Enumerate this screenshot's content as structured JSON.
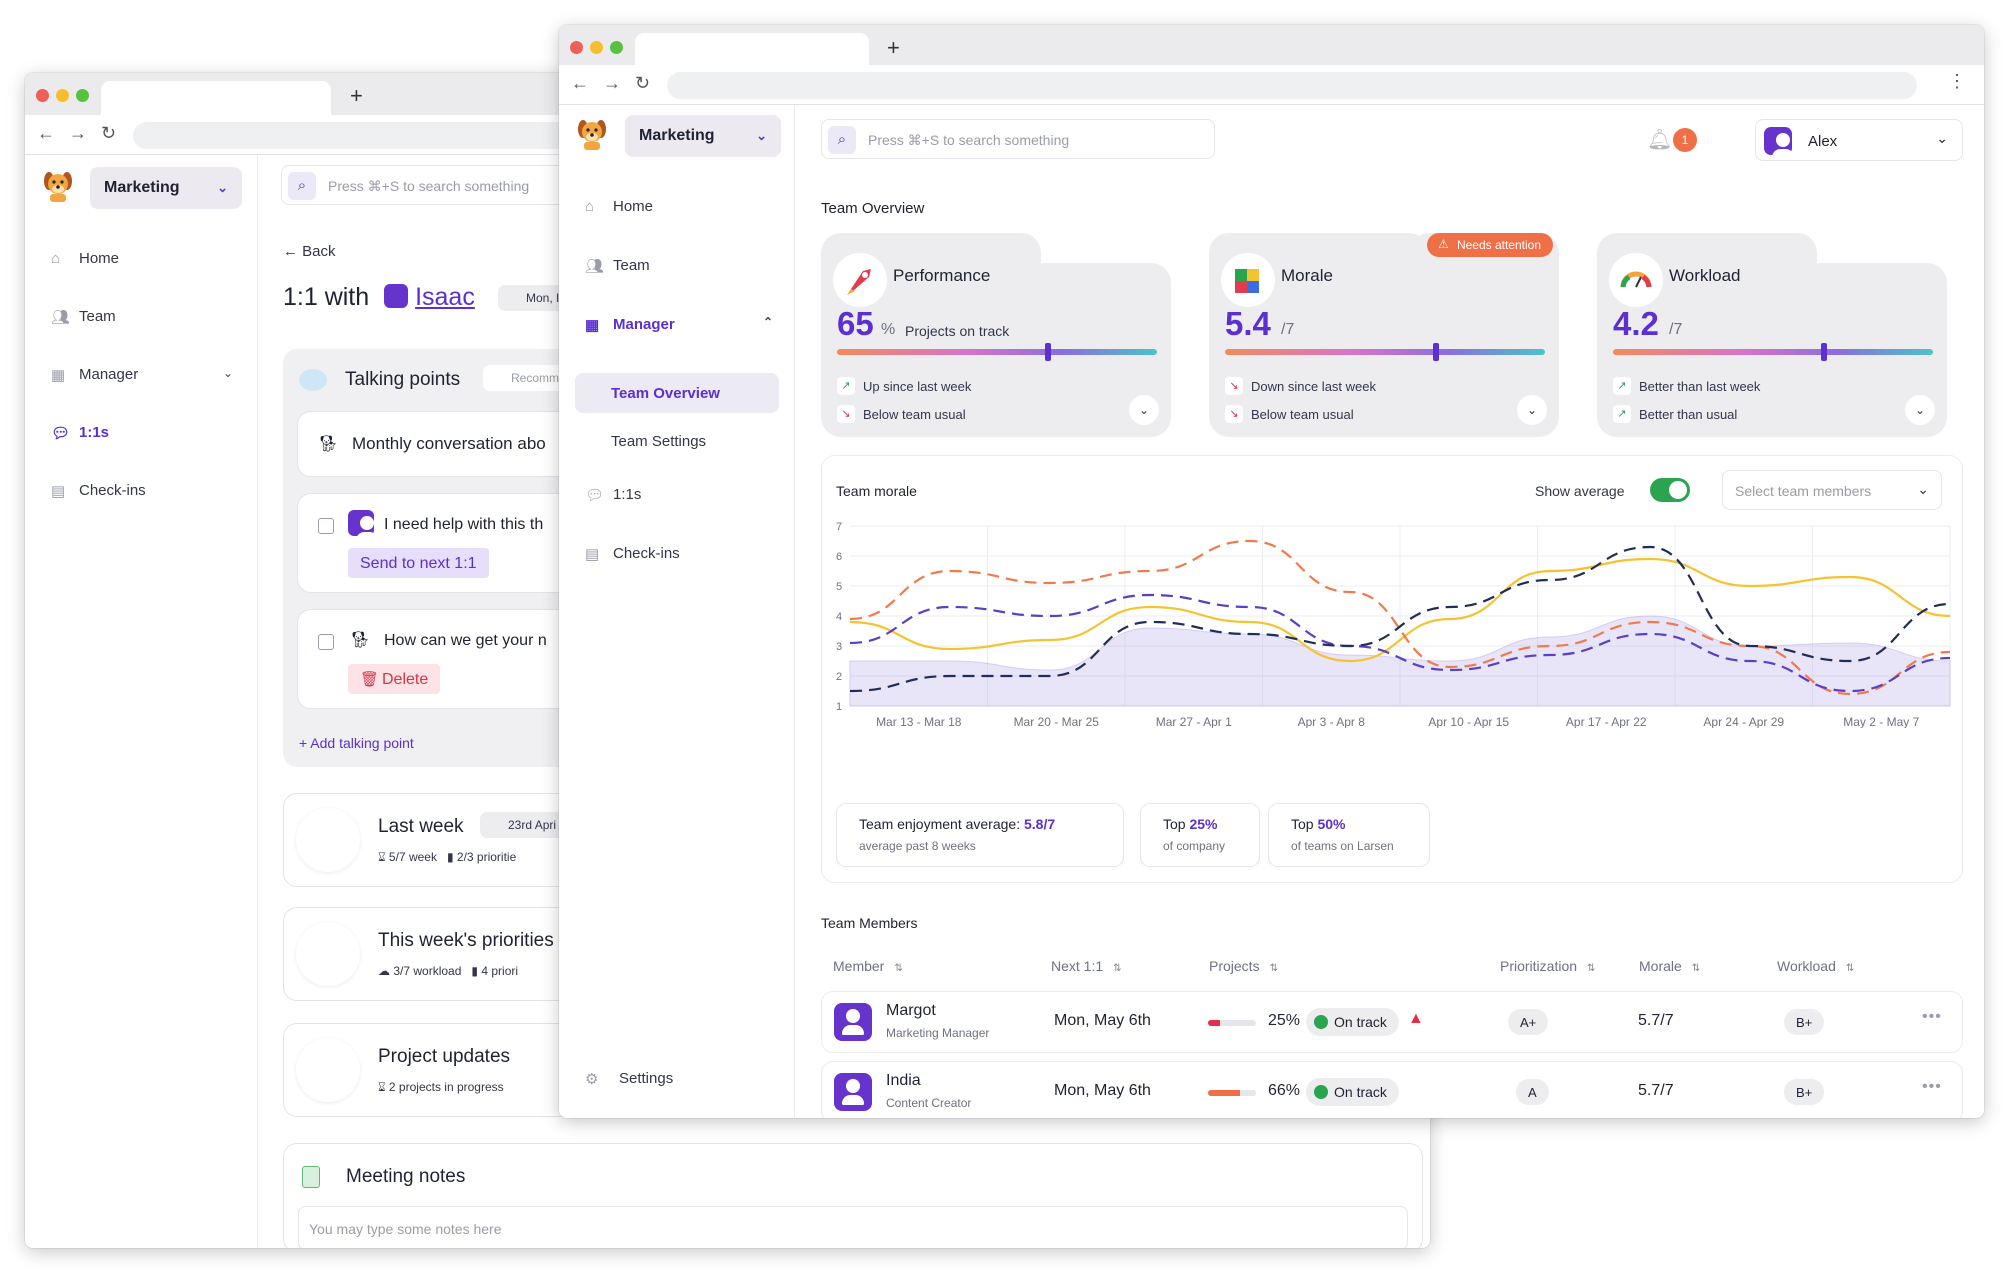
{
  "back_window": {
    "workspace": "Marketing",
    "search_placeholder": "Press ⌘+S to search something",
    "sidebar": [
      {
        "label": "Home",
        "icon": "home-icon"
      },
      {
        "label": "Team",
        "icon": "team-icon"
      },
      {
        "label": "Manager",
        "icon": "manager-icon"
      },
      {
        "label": "1:1s",
        "icon": "chat-icon"
      },
      {
        "label": "Check-ins",
        "icon": "document-icon"
      }
    ],
    "back": "Back",
    "title_prefix": "1:1 with",
    "title_person": "Isaac",
    "date_chip": "Mon, I",
    "talking_points": {
      "title": "Talking points",
      "chip": "Recomm",
      "items": [
        {
          "text": "Monthly conversation abo"
        },
        {
          "text": "I need help with this th",
          "action": "Send to next 1:1"
        },
        {
          "text": "How can we get your n",
          "action": "Delete"
        }
      ],
      "add": "Add talking point"
    },
    "sections": [
      {
        "title": "Last week",
        "chip": "23rd Apri",
        "m1": "5/7 week",
        "m2": "2/3 prioritie"
      },
      {
        "title": "This week's priorities",
        "m1": "3/7 workload",
        "m2": "4 priori"
      },
      {
        "title": "Project updates",
        "m1": "2 projects in progress",
        "m2": ""
      }
    ],
    "notes": {
      "title": "Meeting notes",
      "placeholder": "You may type some notes here"
    }
  },
  "front_window": {
    "workspace": "Marketing",
    "sidebar": {
      "home": "Home",
      "team": "Team",
      "manager": "Manager",
      "team_overview": "Team Overview",
      "team_settings": "Team Settings",
      "ones": "1:1s",
      "checkins": "Check-ins",
      "settings": "Settings"
    },
    "search_placeholder": "Press ⌘+S to search something",
    "notif_count": "1",
    "user": "Alex",
    "section_title": "Team Overview",
    "kpis": [
      {
        "name": "Performance",
        "value": "65",
        "unit": "%",
        "extra": "Projects on track",
        "level": 0.66,
        "t1": "Up since last week",
        "t2": "Below team usual",
        "t1dir": "up",
        "t2dir": "down"
      },
      {
        "name": "Morale",
        "value": "5.4",
        "unit": "/7",
        "extra": "",
        "level": 0.66,
        "badge": "Needs attention",
        "t1": "Down since last week",
        "t2": "Below team usual",
        "t1dir": "down",
        "t2dir": "down"
      },
      {
        "name": "Workload",
        "value": "4.2",
        "unit": "/7",
        "extra": "",
        "level": 0.66,
        "t1": "Better than last week",
        "t2": "Better than usual",
        "t1dir": "up",
        "t2dir": "up"
      }
    ],
    "chart_head": {
      "title": "Team morale",
      "show_avg": "Show average",
      "select": "Select team members"
    },
    "stats": [
      {
        "l1a": "Team enjoyment average: ",
        "l1b": "5.8/7",
        "l2": "average past 8 weeks"
      },
      {
        "l1a": "Top ",
        "l1b": "25%",
        "l2": "of company"
      },
      {
        "l1a": "Top ",
        "l1b": "50%",
        "l2": "of teams on Larsen"
      }
    ],
    "members_title": "Team Members",
    "columns": [
      "Member",
      "Next 1:1",
      "Projects",
      "Prioritization",
      "Morale",
      "Workload"
    ],
    "members": [
      {
        "name": "Margot",
        "role": "Marketing Manager",
        "next": "Mon, May 6th",
        "pct": "25%",
        "pct_val": 0.25,
        "bar_color": "#e0304a",
        "status": "On track",
        "warn": true,
        "prio": "A+",
        "morale": "5.7/7",
        "workload": "B+"
      },
      {
        "name": "India",
        "role": "Content Creator",
        "next": "Mon, May 6th",
        "pct": "66%",
        "pct_val": 0.66,
        "bar_color": "#ef6f46",
        "status": "On track",
        "warn": false,
        "prio": "A",
        "morale": "5.7/7",
        "workload": "B+"
      }
    ]
  },
  "chart_data": {
    "type": "line",
    "title": "Team morale",
    "categories": [
      "Mar 13 - Mar 18",
      "Mar 20 - Mar 25",
      "Mar 27 - Apr 1",
      "Apr 3 - Apr 8",
      "Apr 10 - Apr 15",
      "Apr 17 - Apr 22",
      "Apr 24 - Apr 29",
      "May 2 - May 7"
    ],
    "ylim": [
      1,
      7
    ],
    "yticks": [
      1,
      2,
      3,
      4,
      5,
      6,
      7
    ],
    "grid": true,
    "series": [
      {
        "color": "#f07a4c",
        "style": "dashed",
        "values": [
          3.9,
          5.5,
          5.1,
          5.5,
          6.5,
          4.8,
          2.3,
          3.0,
          3.8,
          3.0,
          1.4,
          2.8
        ]
      },
      {
        "color": "#5b3fc4",
        "style": "dashed",
        "values": [
          3.1,
          4.3,
          4.0,
          4.7,
          4.3,
          3.0,
          2.2,
          2.7,
          3.4,
          2.5,
          1.5,
          2.6
        ]
      },
      {
        "color": "#f4c430",
        "style": "solid",
        "values": [
          3.8,
          2.9,
          3.2,
          4.3,
          3.8,
          2.5,
          3.9,
          5.5,
          5.9,
          5.0,
          5.3,
          4.0
        ]
      },
      {
        "color": "#1f2e57",
        "style": "dashed",
        "values": [
          1.5,
          2.0,
          2.0,
          3.8,
          3.4,
          3.0,
          4.3,
          5.2,
          6.3,
          3.0,
          2.5,
          4.4
        ]
      },
      {
        "color": "#b7a8e8",
        "style": "area",
        "values": [
          2.5,
          2.5,
          2.2,
          3.6,
          3.4,
          2.7,
          2.5,
          3.3,
          4.0,
          3.0,
          3.1,
          2.5
        ]
      }
    ]
  }
}
